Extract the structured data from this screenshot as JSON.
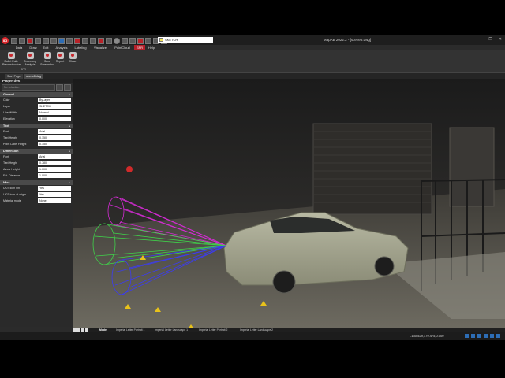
{
  "app": {
    "logo_text": "IDI",
    "title": "MapAB 2022.2 - [scene8.dwg]"
  },
  "layer_combo": {
    "value": "SKETCH",
    "swatch_color": "#f2e35b"
  },
  "window_controls": [
    "–",
    "❐",
    "✕"
  ],
  "menu": [
    "Data",
    "Draw",
    "Edit",
    "Analysis",
    "Labeling",
    "Visualize",
    "PointCloud",
    "SFR",
    "Help"
  ],
  "menu_active": "SFR",
  "ribbon": {
    "buttons": [
      {
        "label": "Bullet Path Reconstruction",
        "icon": "bullet-path-icon"
      },
      {
        "label": "Trajectory Analysis",
        "icon": "trajectory-icon"
      },
      {
        "label": "Save Screenshot",
        "icon": "screenshot-icon"
      },
      {
        "label": "Report",
        "icon": "report-icon"
      },
      {
        "label": "Close",
        "icon": "close-icon"
      }
    ],
    "group_label": "SFR"
  },
  "document_tabs": [
    "Start Page",
    "scene8.dwg"
  ],
  "document_active": "scene8.dwg",
  "properties": {
    "title": "Properties",
    "search_placeholder": "No selection",
    "sections": [
      {
        "name": "General",
        "rows": [
          {
            "key": "Color",
            "value": "ByLayer",
            "swatch": "#ffffff"
          },
          {
            "key": "Layer",
            "value": "SKETCH"
          },
          {
            "key": "Line Width",
            "value": "Normal"
          },
          {
            "key": "Elevation",
            "value": "0.000"
          }
        ]
      },
      {
        "name": "Text",
        "rows": [
          {
            "key": "Font",
            "value": "Arial"
          },
          {
            "key": "Text Height",
            "value": "0.150"
          },
          {
            "key": "Point Label Height",
            "value": "0.150"
          }
        ]
      },
      {
        "name": "Dimension",
        "rows": [
          {
            "key": "Font",
            "value": "Arial"
          },
          {
            "key": "Text Height",
            "value": "0.780"
          },
          {
            "key": "Arrow Height",
            "value": "1.000"
          },
          {
            "key": "Ext. Distance",
            "value": "1.000"
          }
        ]
      },
      {
        "name": "Misc",
        "rows": [
          {
            "key": "UCS icon On",
            "value": "Yes"
          },
          {
            "key": "UCS icon at origin",
            "value": "Yes"
          },
          {
            "key": "Material mode",
            "value": "None"
          }
        ]
      }
    ]
  },
  "layout_tabs": [
    "Model",
    "Imperial Letter Portrait 1",
    "Imperial Letter Landscape 1",
    "Imperial Letter Portrait 2",
    "Imperial Letter Landscape 2"
  ],
  "layout_active": "Model",
  "status": {
    "coordinates": "-130.529,179.475,0.000"
  },
  "viewport": {
    "trajectory_colors": [
      "#d42bd4",
      "#3fd44a",
      "#3c3cf0"
    ]
  }
}
